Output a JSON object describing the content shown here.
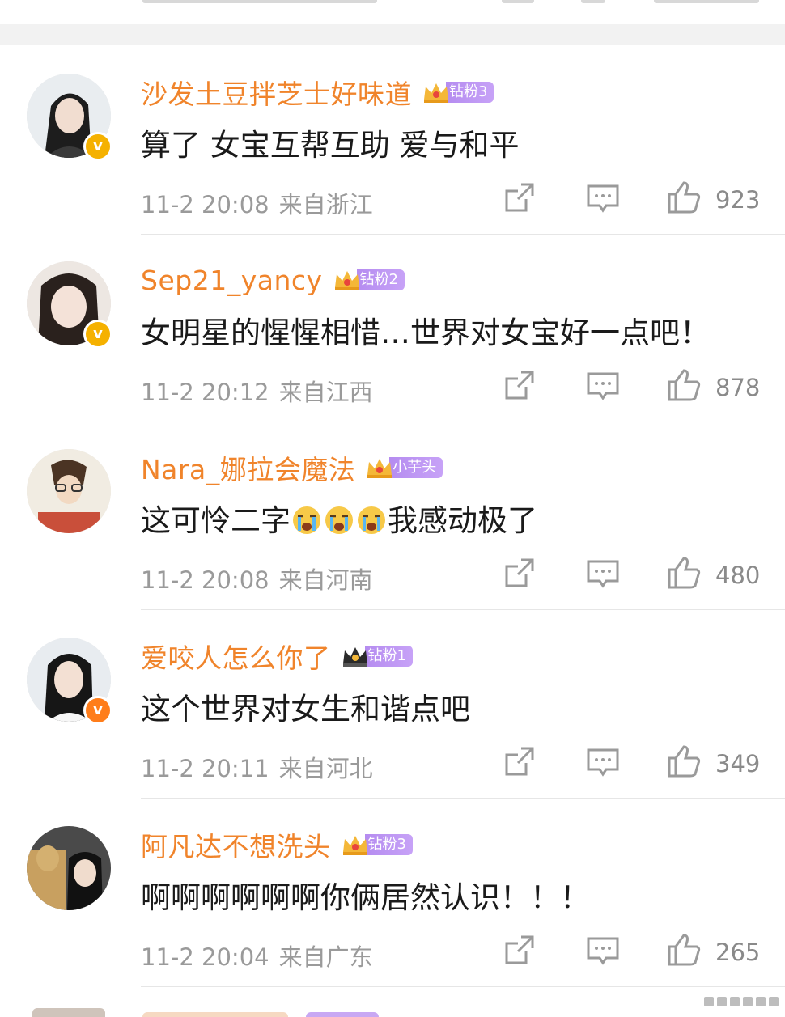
{
  "comments": [
    {
      "username": "沙发土豆拌芝士好味道",
      "fan_badge": "钻粉3",
      "text": "算了 女宝互帮互助 爱与和平",
      "time": "11-2 20:08",
      "location": "来自浙江",
      "likes": "923",
      "verified_color": "#f5b100"
    },
    {
      "username": "Sep21_yancy",
      "fan_badge": "钻粉2",
      "text": "女明星的惺惺相惜…世界对女宝好一点吧！",
      "time": "11-2 20:12",
      "location": "来自江西",
      "likes": "878",
      "verified_color": "#f5b100"
    },
    {
      "username": "Nara_娜拉会魔法",
      "fan_badge": "小芋头",
      "text_before": "这可怜二字",
      "emojis": [
        "crying-emoji",
        "crying-emoji",
        "crying-emoji"
      ],
      "text_after": "我感动极了",
      "time": "11-2 20:08",
      "location": "来自河南",
      "likes": "480"
    },
    {
      "username": "爱咬人怎么你了",
      "fan_badge": "钻粉1",
      "text": "这个世界对女生和谐点吧",
      "time": "11-2 20:11",
      "location": "来自河北",
      "likes": "349",
      "verified_color": "#ff7d1a"
    },
    {
      "username": "阿凡达不想洗头",
      "fan_badge": "钻粉3",
      "text": "啊啊啊啊啊啊你俩居然认识！！！",
      "time": "11-2 20:04",
      "location": "来自广东",
      "likes": "265"
    }
  ],
  "icons": {
    "share": "share-icon",
    "reply": "comment-icon",
    "like": "thumbs-up-icon",
    "verified": "verified-v-icon",
    "crown": "crown-icon"
  },
  "colors": {
    "username": "#f0842b",
    "fan_badge": "#b58cf0",
    "meta": "#9a9a9a",
    "content": "#1a1a1a"
  }
}
